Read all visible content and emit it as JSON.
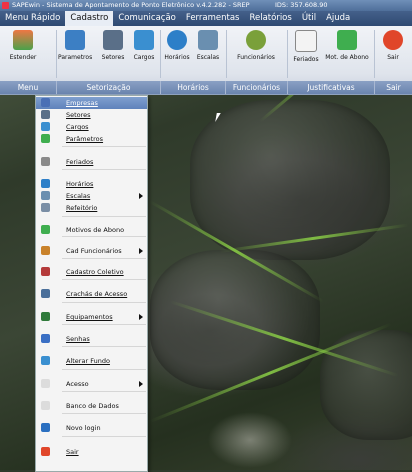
{
  "window": {
    "title": "SAPEwin - Sistema de Apontamento de Ponto Eletrônico  v.4.2.282 - SREP",
    "ids": "IDS: 357.608.90"
  },
  "menubar": [
    "Menu Rápido",
    "Cadastro",
    "Comunicação",
    "Ferramentas",
    "Relatórios",
    "Útil",
    "Ajuda"
  ],
  "ribbon": {
    "tools": [
      {
        "label": "Estender",
        "icon": "extend-icon",
        "color": "#4aa14a"
      },
      {
        "label": "Parametros",
        "icon": "parameters-icon",
        "color": "#3c7fc4"
      },
      {
        "label": "Setores",
        "icon": "sectors-icon",
        "color": "#5a6f88"
      },
      {
        "label": "Cargos",
        "icon": "positions-icon",
        "color": "#3a8fd0"
      },
      {
        "label": "Horários",
        "icon": "clock-icon",
        "color": "#2d7fc8"
      },
      {
        "label": "Escalas",
        "icon": "schedule-icon",
        "color": "#6a8fb0"
      },
      {
        "label": "Funcionários",
        "icon": "employees-icon",
        "color": "#7aa03a"
      },
      {
        "label": "Feriados",
        "icon": "calendar-icon",
        "color": "#8a8a8a"
      },
      {
        "label": "Mot. de Abono",
        "icon": "allowance-icon",
        "color": "#3fae4f"
      },
      {
        "label": "Sair",
        "icon": "exit-icon",
        "color": "#e0462a"
      }
    ],
    "groups": [
      "Menu",
      "Setorização",
      "Horários",
      "Funcionários",
      "Justificativas",
      "Sair"
    ]
  },
  "dropdown": {
    "items": [
      {
        "label": "Empresas",
        "icon": "company-icon",
        "color": "#4a6fb5",
        "submenu": false,
        "highlight": true,
        "underline": true
      },
      {
        "label": "Setores",
        "icon": "sectors-icon",
        "color": "#5a6f88",
        "submenu": false,
        "underline": true
      },
      {
        "label": "Cargos",
        "icon": "positions-icon",
        "color": "#3a8fd0",
        "submenu": false,
        "underline": true
      },
      {
        "label": "Parâmetros",
        "icon": "parameters-icon",
        "color": "#3fae4f",
        "submenu": false,
        "underline": true
      },
      {
        "label": "Feriados",
        "icon": "calendar-icon",
        "color": "#8a8a8a",
        "submenu": false,
        "underline": true
      },
      {
        "label": "Horários",
        "icon": "clock-icon",
        "color": "#2d7fc8",
        "submenu": false,
        "underline": true
      },
      {
        "label": "Escalas",
        "icon": "schedule-icon",
        "color": "#6a8fb0",
        "submenu": true,
        "underline": true
      },
      {
        "label": "Refeitório",
        "icon": "restaurant-icon",
        "color": "#7a8ea5",
        "submenu": false,
        "underline": true
      },
      {
        "label": "Motivos de Abono",
        "icon": "allowance-icon",
        "color": "#3fae4f",
        "submenu": false,
        "underline": false
      },
      {
        "label": "Cad Funcionários",
        "icon": "employees-icon",
        "color": "#c9822a",
        "submenu": true,
        "underline": false
      },
      {
        "label": "Cadastro Coletivo",
        "icon": "collective-icon",
        "color": "#b43a3a",
        "submenu": false,
        "underline": true
      },
      {
        "label": "Crachás de Acesso",
        "icon": "badge-icon",
        "color": "#4a6f9a",
        "submenu": false,
        "underline": true
      },
      {
        "label": "Equipamentos",
        "icon": "equipment-icon",
        "color": "#2f7a3a",
        "submenu": true,
        "underline": true
      },
      {
        "label": "Senhas",
        "icon": "password-icon",
        "color": "#3a6fc4",
        "submenu": false,
        "underline": true
      },
      {
        "label": "Alterar Fundo",
        "icon": "wallpaper-icon",
        "color": "#3a8fd0",
        "submenu": false,
        "underline": true
      },
      {
        "label": "Acesso",
        "icon": "access-icon",
        "color": "#dcdcdc",
        "submenu": true,
        "underline": false
      },
      {
        "label": "Banco de Dados",
        "icon": "database-icon",
        "color": "#dcdcdc",
        "submenu": false,
        "underline": false
      },
      {
        "label": "Novo login",
        "icon": "login-icon",
        "color": "#2a6fc0",
        "submenu": false,
        "underline": false
      },
      {
        "label": "Sair",
        "icon": "exit-icon",
        "color": "#e0462a",
        "submenu": false,
        "underline": true
      }
    ]
  }
}
